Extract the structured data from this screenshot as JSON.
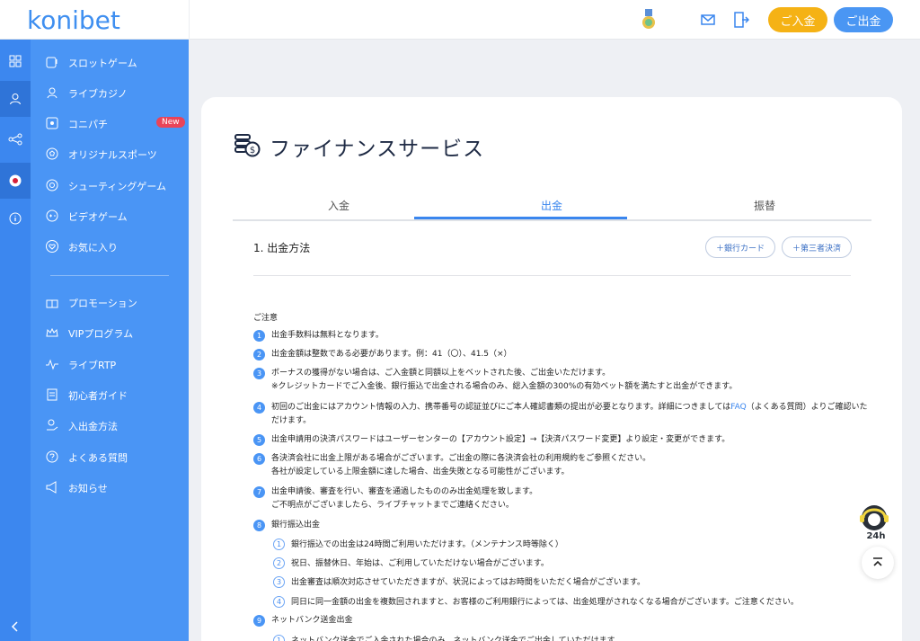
{
  "header": {
    "logo_text": "konibet",
    "deposit_label": "ご入金",
    "withdraw_label": "ご出金",
    "icons": [
      "medal-icon",
      "mail-icon",
      "logout-icon"
    ]
  },
  "rail": {
    "icons": [
      "grid-icon",
      "user-icon",
      "share-icon",
      "japan-flag-icon",
      "info-icon"
    ],
    "collapse_icon": "chevron-left-icon"
  },
  "sidebar": {
    "items": [
      {
        "label": "スロットゲーム",
        "icon": "slot-icon"
      },
      {
        "label": "ライブカジノ",
        "icon": "live-casino-icon"
      },
      {
        "label": "コニパチ",
        "icon": "pachinko-icon",
        "badge": "New"
      },
      {
        "label": "オリジナルスポーツ",
        "icon": "sports-icon"
      },
      {
        "label": "シューティングゲーム",
        "icon": "target-icon"
      },
      {
        "label": "ビデオゲーム",
        "icon": "gamepad-icon"
      },
      {
        "label": "お気に入り",
        "icon": "heart-icon"
      },
      {
        "label": "プロモーション",
        "icon": "gift-icon"
      },
      {
        "label": "VIPプログラム",
        "icon": "crown-icon"
      },
      {
        "label": "ライブRTP",
        "icon": "pulse-icon"
      },
      {
        "label": "初心者ガイド",
        "icon": "guide-icon"
      },
      {
        "label": "入出金方法",
        "icon": "money-hand-icon"
      },
      {
        "label": "よくある質問",
        "icon": "question-icon"
      },
      {
        "label": "お知らせ",
        "icon": "megaphone-icon"
      }
    ]
  },
  "main": {
    "title": "ファイナンスサービス",
    "tabs": [
      "入金",
      "出金",
      "振替"
    ],
    "active_tab": "出金",
    "section_title": "1. 出金方法",
    "add_bank_label": "＋銀行カード",
    "add_third_party_label": "＋第三者決済",
    "notes_title": "ご注意",
    "notes": [
      {
        "n": "1",
        "line1": "出金手数料は無料となります。"
      },
      {
        "n": "2",
        "line1": "出金金額は整数である必要があります。例：41（〇）、41.5（×）"
      },
      {
        "n": "3",
        "line1": "ボーナスの獲得がない場合は、ご入金額と同額以上をベットされた後、ご出金いただけます。",
        "line2": "※クレジットカードでご入金後、銀行振込で出金される場合のみ、総入金額の300%の有効ベット額を満たすと出金ができます。"
      },
      {
        "n": "4",
        "line1a": "初回のご出金にはアカウント情報の入力、携帯番号の認証並びにご本人確認書類の提出が必要となります。詳細につきましては",
        "faq": "FAQ",
        "line1b": "（よくある質問）よりご確認いた",
        "line2": "だけます。"
      },
      {
        "n": "5",
        "line1": "出金申請用の決済パスワードはユーザーセンターの【アカウント設定】→【決済パスワード変更】より設定・変更ができます。"
      },
      {
        "n": "6",
        "line1": "各決済会社に出金上限がある場合がございます。ご出金の際に各決済会社の利用規約をご参照ください。",
        "line2": "各社が設定している上限金額に達した場合、出金失敗となる可能性がございます。"
      },
      {
        "n": "7",
        "line1": "出金申請後、審査を行い、審査を通過したもののみ出金処理を致します。",
        "line2": "ご不明点がございましたら、ライブチャットまでご連絡ください。"
      },
      {
        "n": "8",
        "line1": "銀行振込出金"
      },
      {
        "n": "9",
        "line1": "ネットバンク送金出金"
      }
    ],
    "bank_subnotes": [
      {
        "n": "1",
        "text": "銀行振込での出金は24時間ご利用いただけます。（メンテナンス時等除く）"
      },
      {
        "n": "2",
        "text": "祝日、振替休日、年始は、ご利用していただけない場合がございます。"
      },
      {
        "n": "3",
        "text": "出金審査は順次対応させていただきますが、状況によってはお時間をいただく場合がございます。"
      },
      {
        "n": "4",
        "text": "同日に同一金額の出金を複数回されますと、お客様のご利用銀行によっては、出金処理がされなくなる場合がございます。ご注意ください。"
      }
    ],
    "netbank_subnotes": [
      {
        "n": "1",
        "text": "ネットバンク送金でご入金された場合のみ、ネットバンク送金でご出金していただけます。"
      }
    ]
  },
  "floating": {
    "support_label": "24h"
  },
  "colors": {
    "sidebar": "#4a95f5",
    "rail": "#3c87ef",
    "accent": "#3a86ee",
    "deposit": "#f5b215",
    "badge": "#e94459"
  }
}
